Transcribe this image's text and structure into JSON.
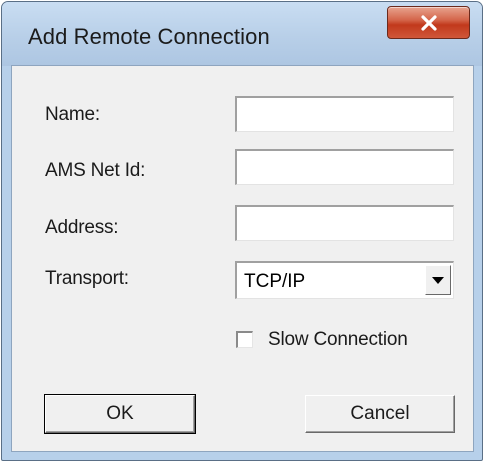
{
  "dialog": {
    "title": "Add Remote Connection",
    "close_icon": "close-icon"
  },
  "form": {
    "name_label": "Name:",
    "name_value": "",
    "ams_label": "AMS Net Id:",
    "ams_value": "",
    "address_label": "Address:",
    "address_value": "",
    "transport_label": "Transport:",
    "transport_value": "TCP/IP",
    "dropdown_icon": "chevron-down-icon",
    "slow_connection_label": "Slow Connection",
    "slow_connection_checked": false
  },
  "buttons": {
    "ok_label": "OK",
    "cancel_label": "Cancel"
  },
  "colors": {
    "close_button": "#c7422a",
    "window_frame": "#b7d0ea",
    "client_area": "#f0f0f0"
  }
}
